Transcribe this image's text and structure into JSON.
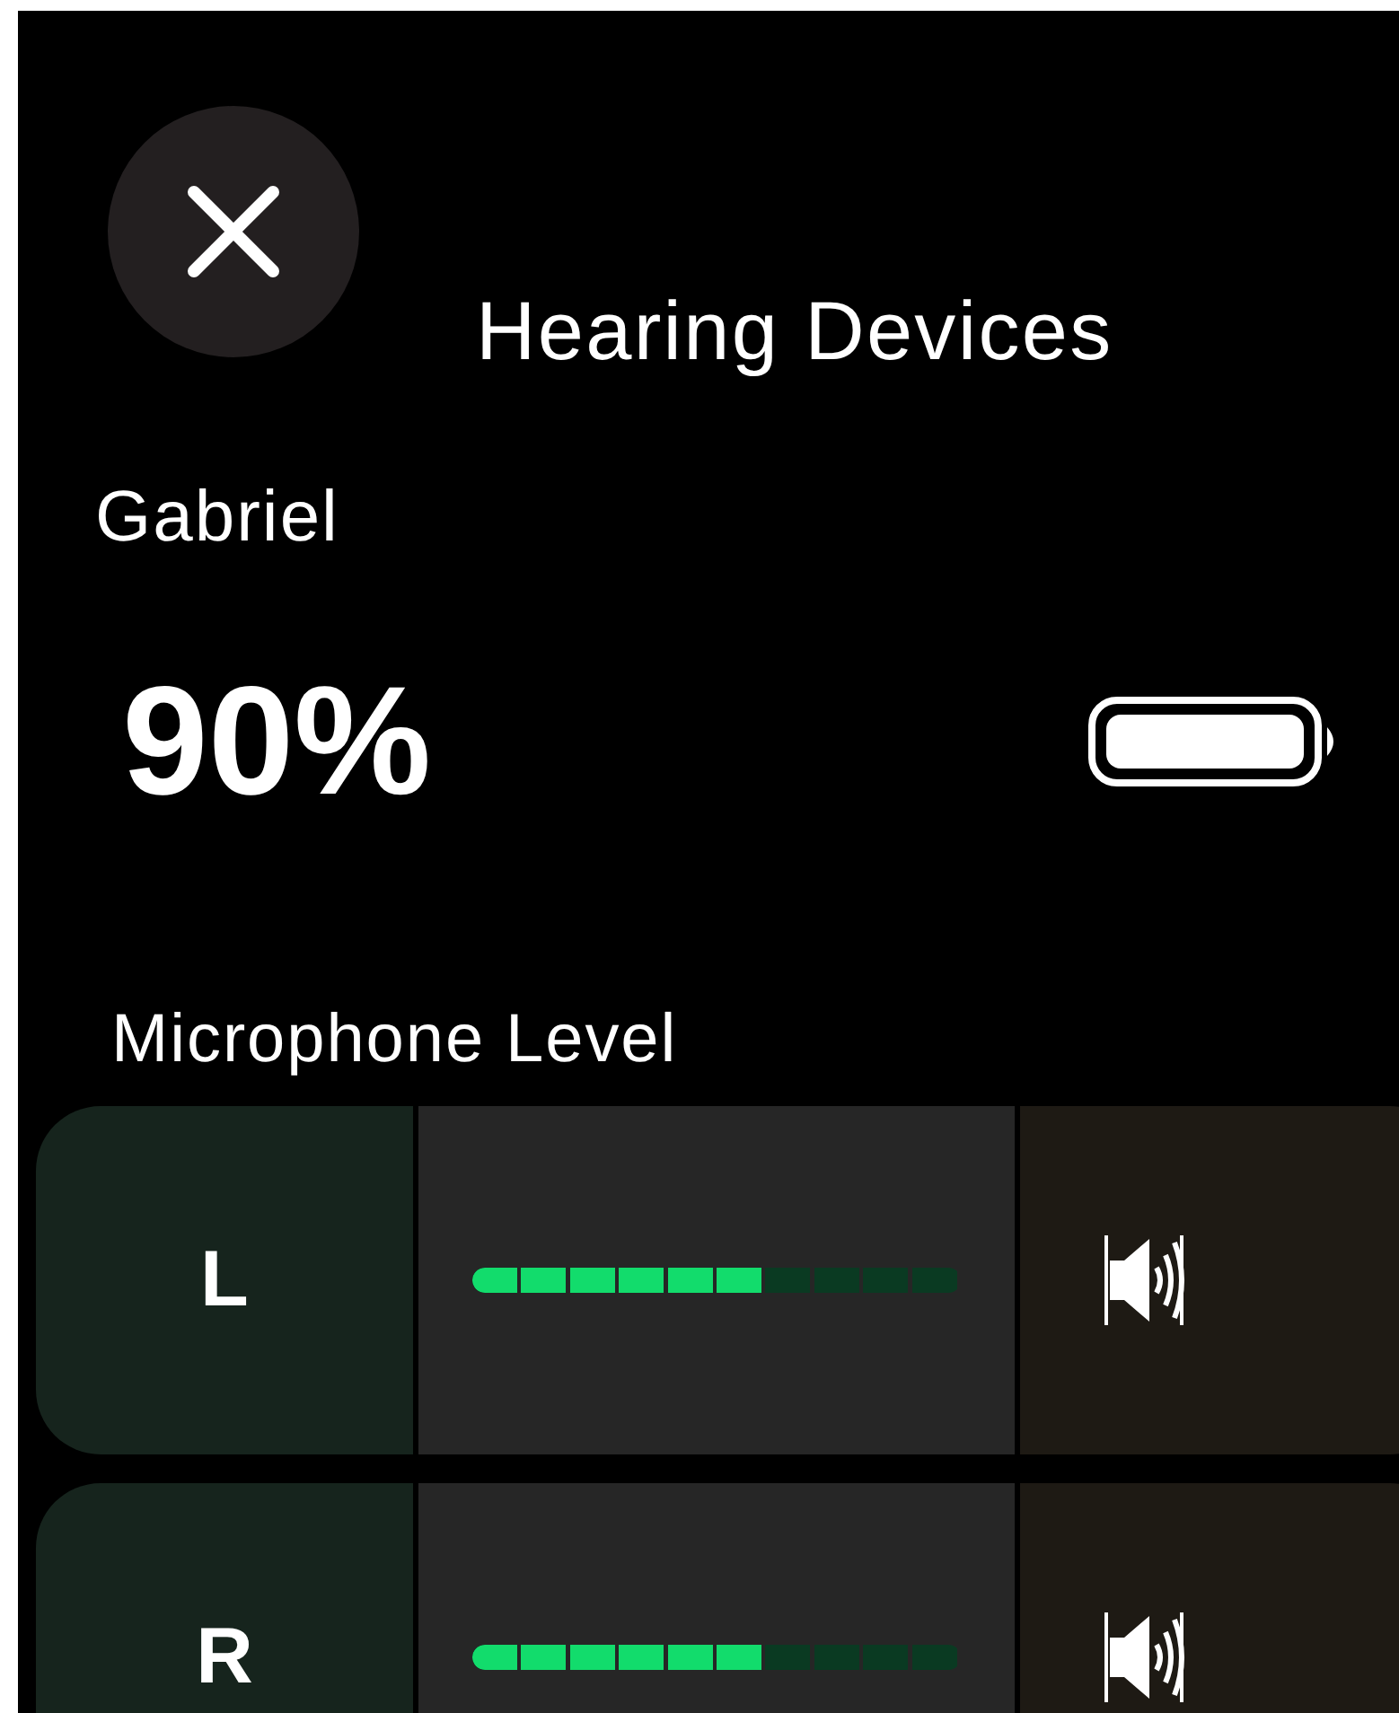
{
  "title": "Hearing Devices",
  "device": {
    "name": "Gabriel",
    "battery": "90%"
  },
  "section_label": "Microphone Level",
  "channels": [
    {
      "label": "L",
      "level": 0.6
    },
    {
      "label": "R",
      "level": 0.6
    }
  ]
}
